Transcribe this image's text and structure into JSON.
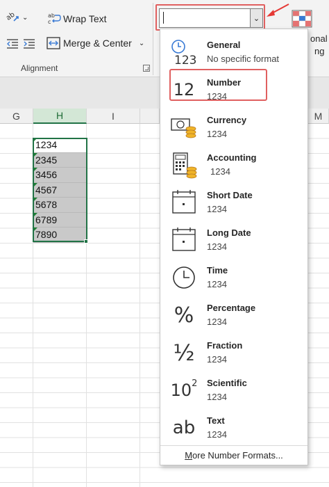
{
  "ribbon": {
    "wrap_text": "Wrap Text",
    "merge_center": "Merge & Center",
    "group_label": "Alignment",
    "format_box_value": "",
    "right_fragment_1": "onal",
    "right_fragment_2": "ng"
  },
  "columns": [
    "G",
    "H",
    "I",
    "M"
  ],
  "cells": [
    "1234",
    "2345",
    "3456",
    "4567",
    "5678",
    "6789",
    "7890"
  ],
  "formats": [
    {
      "title": "General",
      "sample": "No specific format",
      "icon": "clock-123-icon"
    },
    {
      "title": "Number",
      "sample": "1234",
      "icon": "number-12-icon"
    },
    {
      "title": "Currency",
      "sample": "1234",
      "icon": "currency-icon"
    },
    {
      "title": "Accounting",
      "sample": "1234",
      "icon": "accounting-icon"
    },
    {
      "title": "Short Date",
      "sample": "1234",
      "icon": "calendar-icon"
    },
    {
      "title": "Long Date",
      "sample": "1234",
      "icon": "calendar-icon"
    },
    {
      "title": "Time",
      "sample": "1234",
      "icon": "clock-icon"
    },
    {
      "title": "Percentage",
      "sample": "1234",
      "icon": "percent-icon"
    },
    {
      "title": "Fraction",
      "sample": "1234",
      "icon": "fraction-icon"
    },
    {
      "title": "Scientific",
      "sample": "1234",
      "icon": "scientific-icon"
    },
    {
      "title": "Text",
      "sample": "1234",
      "icon": "text-ab-icon"
    }
  ],
  "icon_glyphs": {
    "number": "12",
    "percent": "%",
    "fraction": "½",
    "scientific": "10",
    "scientific_exp": "2",
    "text": "ab",
    "general": "123"
  },
  "more_formats_prefix": "M",
  "more_formats_rest": "ore Number Formats...",
  "colors": {
    "excel_green": "#217346",
    "highlight_red": "#e06060",
    "arrow_red": "#e53935"
  }
}
